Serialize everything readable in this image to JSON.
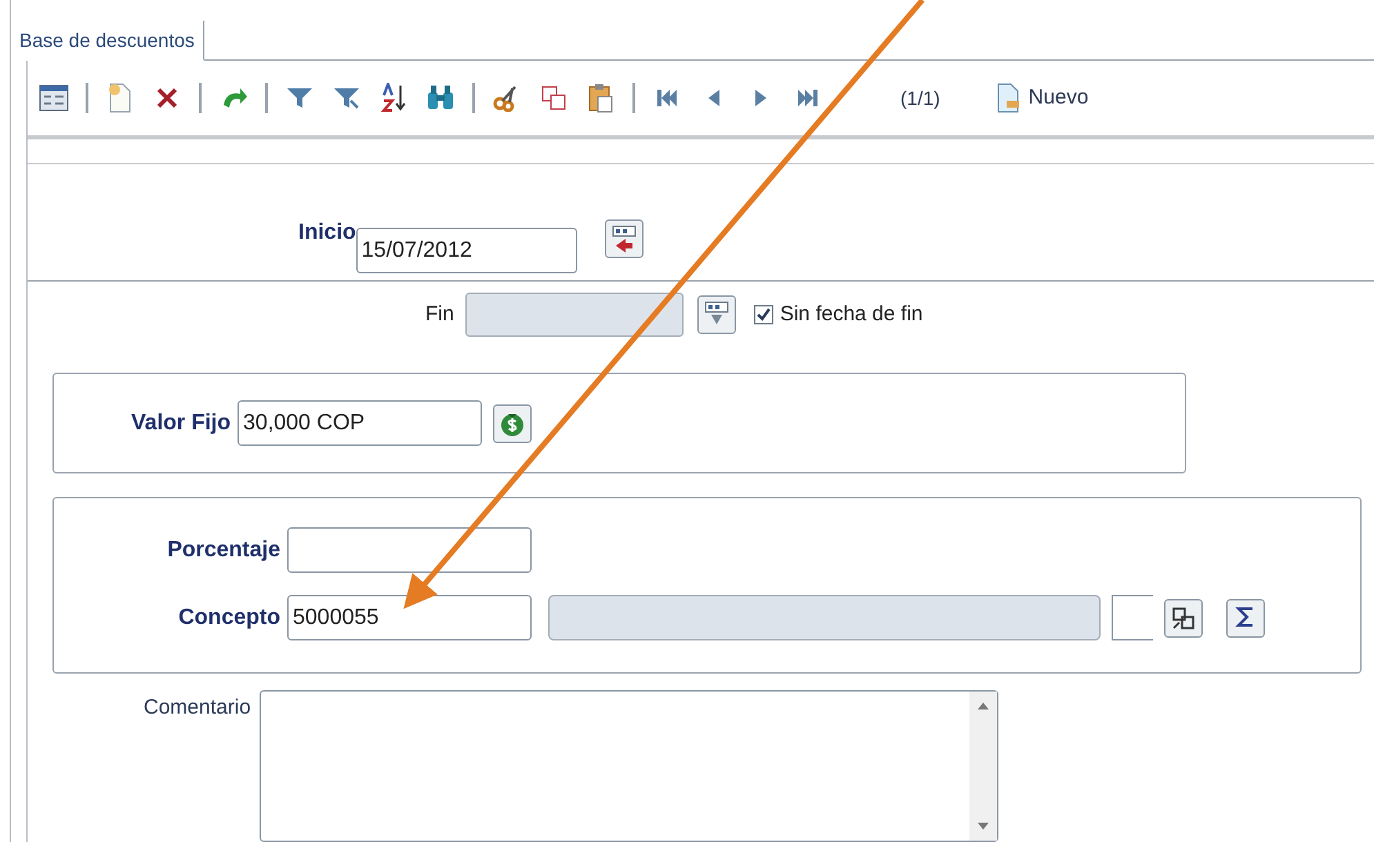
{
  "tab": {
    "label": "Base de descuentos",
    "selected": true
  },
  "toolbar": {
    "record_count": "(1/1)",
    "new_button": "Nuevo"
  },
  "inicio": {
    "label": "Inicio",
    "value": "15/07/2012"
  },
  "fin": {
    "label": "Fin",
    "disabled": true,
    "no_end_date": {
      "label": "Sin fecha de fin",
      "checked": true
    }
  },
  "valor_fijo": {
    "label": "Valor Fijo",
    "value": "30,000 COP"
  },
  "porcentaje": {
    "label": "Porcentaje"
  },
  "concepto": {
    "label": "Concepto",
    "value": "5000055",
    "description_disabled": true
  },
  "comentario": {
    "label": "Comentario"
  }
}
